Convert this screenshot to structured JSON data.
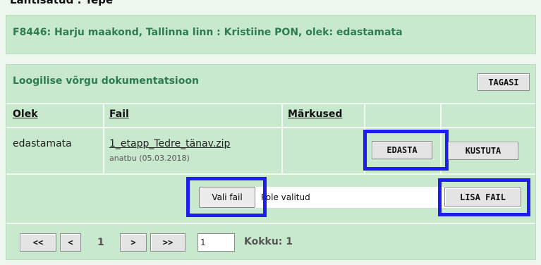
{
  "top_heading": "Lahtisatud : Tepe",
  "header_panel": {
    "title": "F8446: Harju maakond, Tallinna linn : Kristiine PON, olek: edastamata"
  },
  "docs_panel": {
    "title": "Loogilise võrgu dokumentatsioon",
    "back_button": "TAGASI",
    "columns": {
      "olek": "Olek",
      "fail": "Fail",
      "markused": "Märkused"
    },
    "row": {
      "olek": "edastamata",
      "file_name": "1_etapp_Tedre_tänav.zip",
      "file_meta": "anatbu (05.03.2018)",
      "send_button": "EDASTA",
      "delete_button": "KUSTUTA"
    },
    "upload": {
      "choose_button": "Vali fail",
      "chosen_text": "Pole valitud",
      "add_button": "LISA FAIL"
    },
    "pager": {
      "first": "<<",
      "prev": "<",
      "current": "1",
      "next": ">",
      "last": ">>",
      "page_input": "1",
      "total": "Kokku: 1"
    }
  },
  "colors": {
    "panel_bg": "#c9e9cf",
    "title_green": "#2e7d4f",
    "highlight_blue": "#1d1df0"
  }
}
